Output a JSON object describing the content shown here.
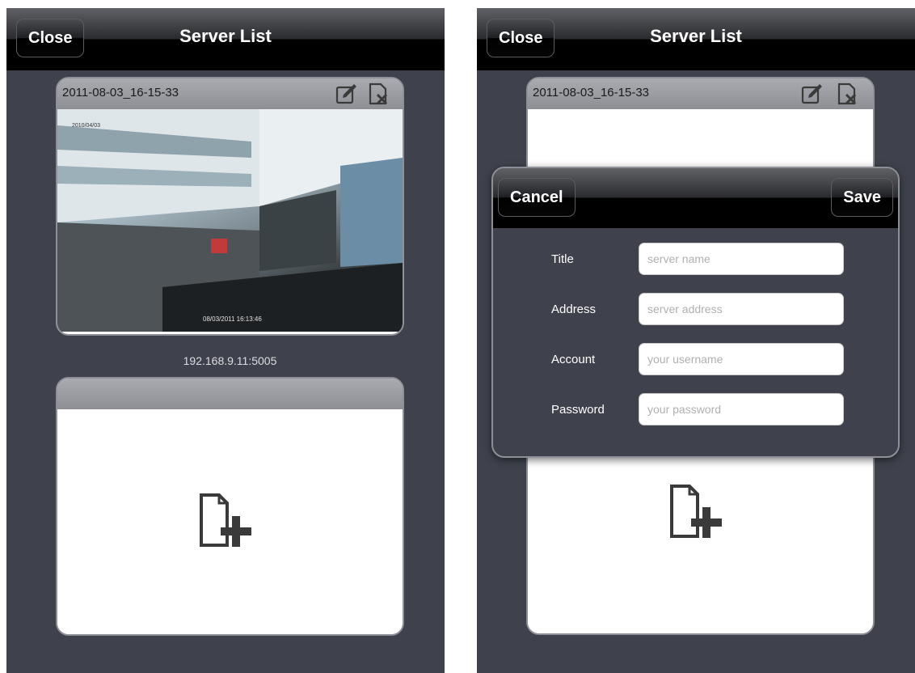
{
  "left_screen": {
    "nav": {
      "close_label": "Close",
      "title": "Server List"
    },
    "server_card": {
      "title": "2011-08-03_16-15-33",
      "address": "192.168.9.11:5005"
    }
  },
  "right_screen": {
    "nav": {
      "close_label": "Close",
      "title": "Server List"
    },
    "server_card": {
      "title": "2011-08-03_16-15-33"
    },
    "dialog": {
      "cancel_label": "Cancel",
      "save_label": "Save",
      "fields": [
        {
          "label": "Title",
          "placeholder": "server name",
          "value": ""
        },
        {
          "label": "Address",
          "placeholder": "server address",
          "value": ""
        },
        {
          "label": "Account",
          "placeholder": "your username",
          "value": ""
        },
        {
          "label": "Password",
          "placeholder": "your password",
          "value": ""
        }
      ]
    }
  },
  "icons": {
    "edit": "edit-icon",
    "delete": "delete-icon",
    "add": "add-server-icon"
  },
  "colors": {
    "background": "#3f424c",
    "card_border": "#8e9097",
    "navbar": "#000000"
  }
}
